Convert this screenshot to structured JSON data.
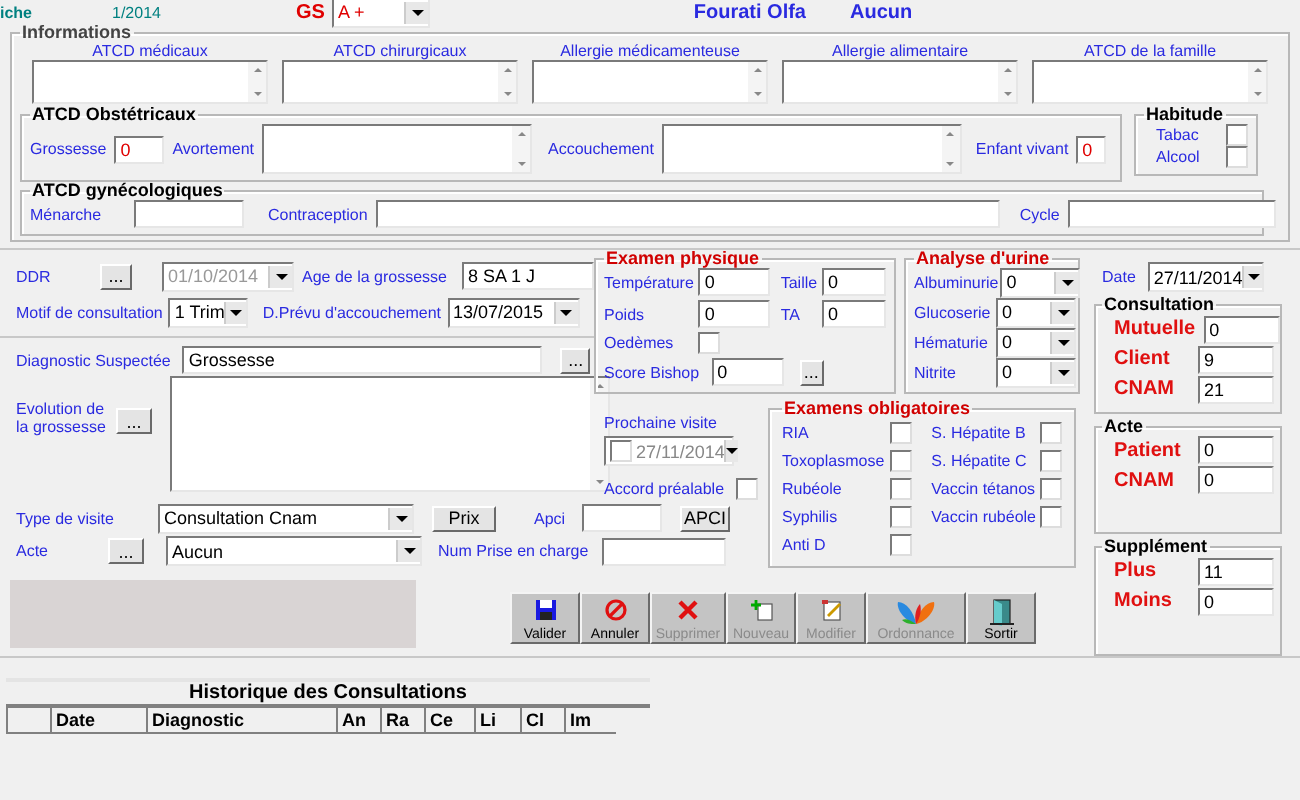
{
  "header": {
    "file_label": "iche",
    "file_number": "1/2014",
    "gs_label": "GS",
    "gs_value": "A +",
    "patient_name": "Fourati Olfa",
    "patient_status": "Aucun"
  },
  "informations": {
    "title": "Informations",
    "atcd_fields": [
      {
        "label": "ATCD médicaux"
      },
      {
        "label": "ATCD chirurgicaux"
      },
      {
        "label": "Allergie médicamenteuse"
      },
      {
        "label": "Allergie alimentaire"
      },
      {
        "label": "ATCD de la famille"
      }
    ],
    "obstetrics": {
      "title": "ATCD Obstétricaux",
      "grossesse": {
        "label": "Grossesse",
        "value": "0"
      },
      "avortement": {
        "label": "Avortement"
      },
      "accouchement": {
        "label": "Accouchement"
      },
      "enfant_vivant": {
        "label": "Enfant vivant",
        "value": "0"
      }
    },
    "habitude": {
      "title": "Habitude",
      "items": [
        {
          "label": "Tabac",
          "checked": false
        },
        {
          "label": "Alcool",
          "checked": false
        }
      ]
    },
    "gynecology": {
      "title": "ATCD gynécologiques",
      "menarche": {
        "label": "Ménarche"
      },
      "contraception": {
        "label": "Contraception"
      },
      "cycle": {
        "label": "Cycle"
      }
    }
  },
  "consultation": {
    "ddr": {
      "label": "DDR",
      "button": "...",
      "value": "01/10/2014",
      "disabled": true
    },
    "age": {
      "label": "Age de la grossesse",
      "value": "8 SA 1 J"
    },
    "motif": {
      "label": "Motif de consultation",
      "value": "1 Trim"
    },
    "prevu": {
      "label": "D.Prévu d'accouchement",
      "value": "13/07/2015"
    },
    "diagnostic": {
      "label": "Diagnostic Suspectée",
      "value": "Grossesse",
      "button": "..."
    },
    "evolution": {
      "label": "Evolution de la grossesse",
      "button": "..."
    },
    "type_visite": {
      "label": "Type de visite",
      "value": "Consultation Cnam"
    },
    "prix_button": "Prix",
    "apci": {
      "label": "Apci",
      "button": "APCI"
    },
    "acte": {
      "label": "Acte",
      "button": "...",
      "value": "Aucun"
    },
    "num_prise": {
      "label": "Num Prise en charge"
    }
  },
  "examen_physique": {
    "title": "Examen physique",
    "fields": [
      {
        "label": "Température",
        "value": "0"
      },
      {
        "label": "Taille",
        "value": "0"
      },
      {
        "label": "Poids",
        "value": "0"
      },
      {
        "label": "TA",
        "value": "0"
      }
    ],
    "oedemes": {
      "label": "Oedèmes",
      "checked": false
    },
    "bishop": {
      "label": "Score Bishop",
      "value": "0",
      "button": "..."
    }
  },
  "analyse_urine": {
    "title": "Analyse d'urine",
    "items": [
      {
        "label": "Albuminurie",
        "value": "0"
      },
      {
        "label": "Glucoserie",
        "value": "0"
      },
      {
        "label": "Hématurie",
        "value": "0"
      },
      {
        "label": "Nitrite",
        "value": "0"
      }
    ]
  },
  "prochaine_visite": {
    "label": "Prochaine visite",
    "date": "27/11/2014",
    "checked": false,
    "accord": {
      "label": "Accord préalable",
      "checked": false
    }
  },
  "examens_obligatoires": {
    "title": "Examens obligatoires",
    "items": [
      {
        "label": "RIA",
        "checked": false
      },
      {
        "label": "Toxoplasmose",
        "checked": false
      },
      {
        "label": "Rubéole",
        "checked": false
      },
      {
        "label": "Syphilis",
        "checked": false
      },
      {
        "label": "Anti D",
        "checked": false
      },
      {
        "label": "S. Hépatite B",
        "checked": false
      },
      {
        "label": "S. Hépatite C",
        "checked": false
      },
      {
        "label": "Vaccin tétanos",
        "checked": false
      },
      {
        "label": "Vaccin rubéole",
        "checked": false
      }
    ]
  },
  "date": {
    "label": "Date",
    "value": "27/11/2014"
  },
  "payments": [
    {
      "title": "Consultation",
      "rows": [
        {
          "label": "Mutuelle",
          "value": "0"
        },
        {
          "label": "Client",
          "value": "9"
        },
        {
          "label": "CNAM",
          "value": "21"
        }
      ]
    },
    {
      "title": "Acte",
      "rows": [
        {
          "label": "Patient",
          "value": "0"
        },
        {
          "label": "CNAM",
          "value": "0"
        }
      ]
    },
    {
      "title": "Supplément",
      "rows": [
        {
          "label": "Plus",
          "value": "11"
        },
        {
          "label": "Moins",
          "value": "0"
        }
      ]
    }
  ],
  "toolbar": [
    {
      "label": "Valider",
      "kind": "save",
      "disabled": false
    },
    {
      "label": "Annuler",
      "kind": "cancel",
      "disabled": false
    },
    {
      "label": "Supprimer",
      "kind": "delete",
      "disabled": true
    },
    {
      "label": "Nouveau",
      "kind": "new",
      "disabled": true
    },
    {
      "label": "Modifier",
      "kind": "edit",
      "disabled": true
    },
    {
      "label": "Ordonnance",
      "kind": "prescription",
      "disabled": true
    },
    {
      "label": "Sortir",
      "kind": "exit",
      "disabled": false
    }
  ],
  "history": {
    "title": "Historique des Consultations",
    "columns": [
      "Date",
      "Diagnostic",
      "An",
      "Ra",
      "Ce",
      "Li",
      "Cl",
      "Im"
    ]
  }
}
